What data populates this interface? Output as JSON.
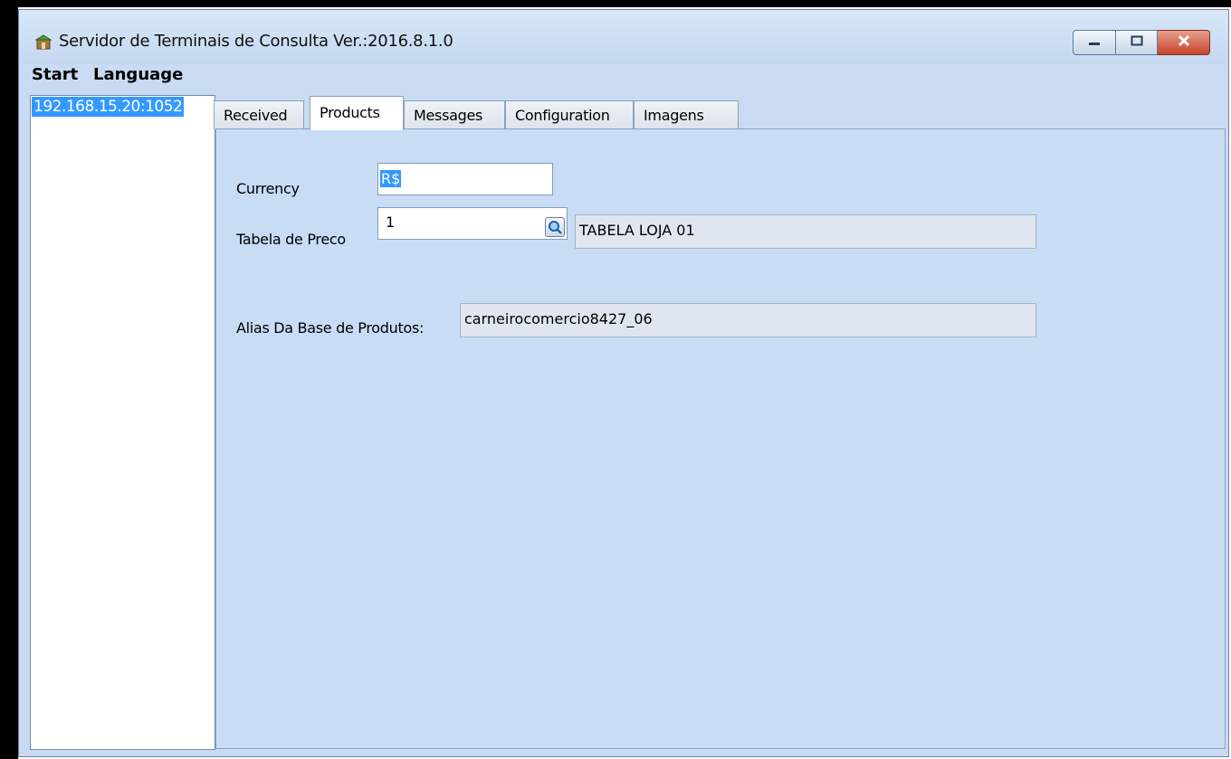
{
  "window": {
    "title": "Servidor de Terminais de Consulta Ver.:2016.8.1.0"
  },
  "menu": {
    "start": "Start",
    "language": "Language"
  },
  "terminals": [
    "192.168.15.20:1052"
  ],
  "tabs": {
    "received": "Received",
    "products": "Products",
    "messages": "Messages",
    "configuration": "Configuration",
    "imagens": "Imagens",
    "active": "Products"
  },
  "products": {
    "currency_label": "Currency",
    "currency_value": "R$",
    "price_table_label": "Tabela de Preco",
    "price_table_value": "1",
    "price_table_name": "TABELA LOJA 01",
    "alias_label": "Alias Da Base de Produtos:",
    "alias_value": "carneirocomercio8427_06"
  },
  "colors": {
    "window_bg": "#c8dbf2",
    "selection": "#3399ff",
    "close_button": "#c6442d"
  },
  "icons": [
    "app-icon",
    "minimize-icon",
    "maximize-icon",
    "close-icon",
    "search-lookup-icon"
  ]
}
